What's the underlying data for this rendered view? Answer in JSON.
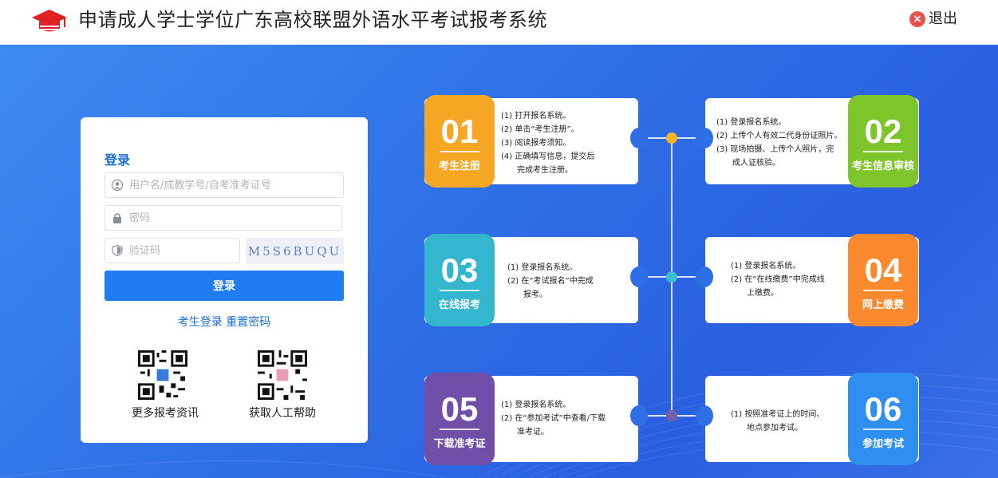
{
  "header": {
    "title": "申请成人学士学位广东高校联盟外语水平考试报考系统",
    "logout_label": "退出"
  },
  "login": {
    "title": "登录",
    "username_placeholder": "用户名/成教学号/自考准考证号",
    "password_placeholder": "密码",
    "captcha_placeholder": "验证码",
    "captcha_text": "M5S6BUQU",
    "submit_label": "登录",
    "link_student_login": "考生登录",
    "link_reset_password": "重置密码",
    "qr_info_label": "更多报考资讯",
    "qr_help_label": "获取人工帮助"
  },
  "steps": [
    {
      "num": "01",
      "name": "考生注册",
      "color": "#f5a623",
      "lines": [
        "(1) 打开报名系统。",
        "(2) 单击“考生注册”。",
        "(3) 阅读报考须知。",
        "(4) 正确填写信息，提交后",
        "　　完成考生注册。"
      ]
    },
    {
      "num": "02",
      "name": "考生信息审核",
      "color": "#7dc52a",
      "lines": [
        "(1) 登录报名系统。",
        "(2) 上传个人有效二代身份证照片。",
        "(3) 现场拍摄、上传个人照片，完",
        "　　成人证核验。"
      ]
    },
    {
      "num": "03",
      "name": "在线报考",
      "color": "#35b6cf",
      "lines": [
        "(1) 登录报名系统。",
        "(2) 在“考试报名”中完成",
        "　　报考。"
      ]
    },
    {
      "num": "04",
      "name": "网上缴费",
      "color": "#fb8a2e",
      "lines": [
        "(1) 登录报名系统。",
        "(2) 在“在线缴费”中完成线",
        "　　上缴费。"
      ]
    },
    {
      "num": "05",
      "name": "下载准考证",
      "color": "#6f4fa8",
      "lines": [
        "(1) 登录报名系统。",
        "(2) 在“参加考试”中查看/下载",
        "　　准考证。"
      ]
    },
    {
      "num": "06",
      "name": "参加考试",
      "color": "#2e8ff0",
      "lines": [
        "(1) 按照准考证上的时间、",
        "　　地点参加考试。"
      ]
    }
  ],
  "colors": {
    "brand_red": "#e02020",
    "primary_blue": "#1f7cf3",
    "link_blue": "#1a6fd1",
    "dot_yellow": "#f5b51f",
    "dot_cyan": "#3cbfd4",
    "dot_purple": "#7a5fa6"
  },
  "icons": [
    "graduation-cap-icon",
    "close-circle-icon",
    "user-icon",
    "lock-icon",
    "shield-icon",
    "qr-code-icon"
  ]
}
